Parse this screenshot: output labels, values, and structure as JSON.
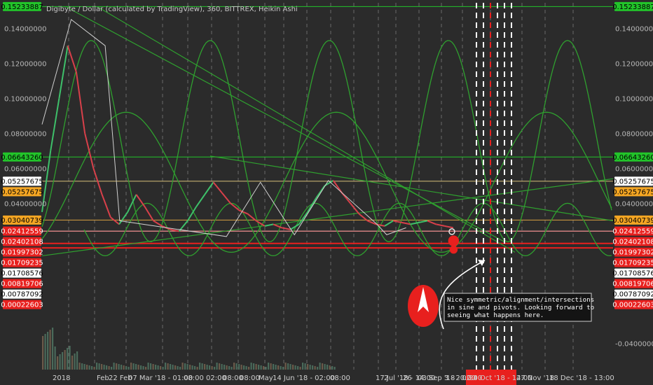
{
  "chart_data": {
    "type": "line",
    "title": "Digibyte / Dollar (calculated by TradingView), 360, BITTREX, Heikin Ashi",
    "ylim": [
      -0.055,
      0.1545
    ],
    "grid": false,
    "y_ticks": [
      "0.14000000",
      "0.12000000",
      "0.10000000",
      "0.08000000",
      "0.06000000",
      "0.04000000",
      "-0.04000000"
    ],
    "y_tick_values": [
      0.14,
      0.12,
      0.1,
      0.08,
      0.06,
      0.04,
      -0.04
    ],
    "left_tick_values": [
      0.14,
      0.12,
      0.1,
      0.08,
      0.06,
      0.04
    ],
    "left_ticks": [
      "0.14000000",
      "0.12000000",
      "0.10000000",
      "0.08000000",
      "0.06000000",
      "0.04000000"
    ],
    "x_labels": [
      "2018",
      "Feb",
      "22 Feb",
      "07 Mar '18 - 01:00",
      "08:00",
      "02:00",
      "08:00",
      "08:00",
      "May",
      "14 Jun '18 - 02:00",
      "08:00",
      "17 Jul '18 - 14:00",
      "2",
      "26",
      "03 Sep '18 - 02:00",
      "3 - 20:00",
      "24 Oct '18 - 14:00",
      "27 Nov '18",
      "18 Dec '18 - 13:00"
    ],
    "price_tags": [
      {
        "label": "0.15233887",
        "value": 0.15233887,
        "bg": "#22c42a",
        "fg": "#000000"
      },
      {
        "label": "0.06643260",
        "value": 0.0664326,
        "bg": "#22c42a",
        "fg": "#000000"
      },
      {
        "label": "0.05257675",
        "value": 0.05257675,
        "bg": "#ffffff",
        "fg": "#000000"
      },
      {
        "label": "0.05257675",
        "value": 0.05257675,
        "bg": "#f5a623",
        "fg": "#000000"
      },
      {
        "label": "0.03040739",
        "value": 0.03040739,
        "bg": "#f5a623",
        "fg": "#000000"
      },
      {
        "label": "0.02402108",
        "value": 0.02402108,
        "bg": "#e8201e",
        "fg": "#ffffff"
      },
      {
        "label": "0.02412559",
        "value": 0.02412559,
        "bg": "#e8201e",
        "fg": "#ffffff"
      },
      {
        "label": "0.01997302",
        "value": 0.01997302,
        "bg": "#e8201e",
        "fg": "#ffffff"
      },
      {
        "label": "0.01708576",
        "value": 0.01708576,
        "bg": "#ffffff",
        "fg": "#000000"
      },
      {
        "label": "0.01709235",
        "value": 0.01709235,
        "bg": "#e8201e",
        "fg": "#ffffff"
      },
      {
        "label": "0.00819706",
        "value": 0.00819706,
        "bg": "#e8201e",
        "fg": "#ffffff"
      },
      {
        "label": "0.00787092",
        "value": 0.00787092,
        "bg": "#ffffff",
        "fg": "#000000"
      },
      {
        "label": "0.00022603",
        "value": 0.00022603,
        "bg": "#e8201e",
        "fg": "#ffffff"
      }
    ],
    "hlines": [
      {
        "value": 0.15233887,
        "color": "#22c42a"
      },
      {
        "value": 0.0664326,
        "color": "#22c42a"
      },
      {
        "value": 0.05257675,
        "color": "#d8c07a"
      },
      {
        "value": 0.03040739,
        "color": "#d8a040"
      },
      {
        "value": 0.02402108,
        "color": "#e05050"
      },
      {
        "value": 0.02412559,
        "color": "#e8a0a0"
      },
      {
        "value": 0.01708576,
        "color": "#e8201e"
      },
      {
        "value": 0.01452,
        "color": "#e8201e"
      }
    ],
    "series": [
      {
        "values": [
          0.035,
          0.07,
          0.1,
          0.13,
          0.115,
          0.08,
          0.06,
          0.045,
          0.032,
          0.028,
          0.035,
          0.045,
          0.038,
          0.03,
          0.027,
          0.025,
          0.024,
          0.03,
          0.038,
          0.045,
          0.052,
          0.046,
          0.04,
          0.036,
          0.034,
          0.03,
          0.027,
          0.028,
          0.026,
          0.025,
          0.028,
          0.035,
          0.043,
          0.05,
          0.053,
          0.046,
          0.04,
          0.034,
          0.03,
          0.028,
          0.027,
          0.03,
          0.029,
          0.028,
          0.029,
          0.03,
          0.028,
          0.027,
          0.026
        ],
        "x": [
          0,
          0.02,
          0.04,
          0.06,
          0.08,
          0.1,
          0.12,
          0.14,
          0.16,
          0.18,
          0.2,
          0.22,
          0.24,
          0.26,
          0.28,
          0.3,
          0.32,
          0.34,
          0.36,
          0.38,
          0.4,
          0.42,
          0.44,
          0.46,
          0.48,
          0.5,
          0.52,
          0.54,
          0.56,
          0.58,
          0.6,
          0.62,
          0.64,
          0.66,
          0.68,
          0.7,
          0.72,
          0.74,
          0.76,
          0.78,
          0.8,
          0.82,
          0.84,
          0.86,
          0.88,
          0.9,
          0.92,
          0.94,
          0.96
        ]
      }
    ],
    "pivot_lines": [
      {
        "x": [
          0.0,
          0.06,
          0.13,
          0.16,
          0.38,
          0.45,
          0.52,
          0.59,
          0.69,
          0.71,
          0.75
        ],
        "y": [
          0.085,
          0.145,
          0.13,
          0.03,
          0.021,
          0.052,
          0.022,
          0.053,
          0.028,
          0.022,
          0.026
        ]
      }
    ],
    "circle_markers": [
      {
        "x": 0.725,
        "value": 0.0238,
        "color": "#e8e8e8",
        "fill": false
      },
      {
        "x": 0.728,
        "value": 0.0185,
        "color": "#e8201e",
        "fill": true
      },
      {
        "x": 0.728,
        "value": 0.0135,
        "color": "#e8201e",
        "fill": true
      }
    ],
    "annotation": "Nice symmetric/alignment/intersections in sine and pivots. Looking forward to seeing what happens here.",
    "annotation_lines": [
      "Nice symmetric/alignment/intersections",
      "in sine and pivots. Looking forward to",
      "seeing what happens here."
    ]
  }
}
